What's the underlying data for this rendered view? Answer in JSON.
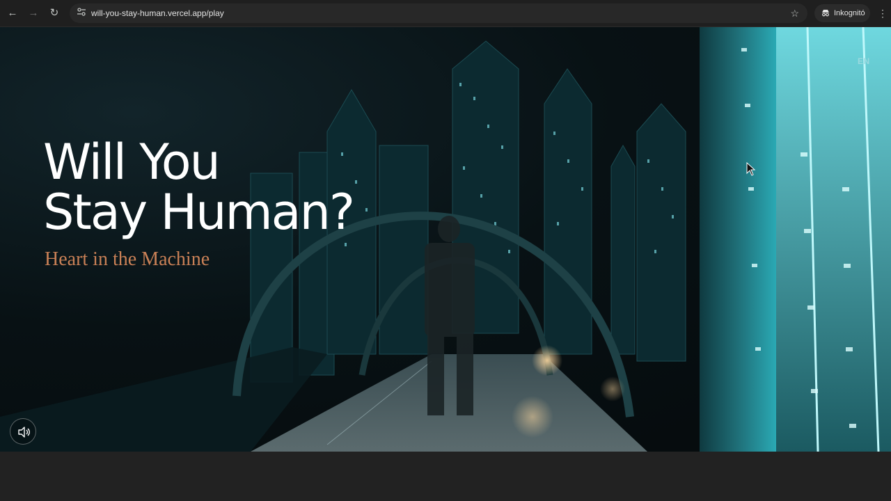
{
  "browser": {
    "url": "will-you-stay-human.vercel.app/play",
    "profile_label": "Inkognitó",
    "icons": {
      "back": "back-arrow-icon",
      "forward": "forward-arrow-icon",
      "reload": "reload-icon",
      "site_info": "site-info-icon",
      "bookmark": "star-icon",
      "incognito": "incognito-icon",
      "menu": "kebab-menu-icon"
    }
  },
  "page": {
    "language_label": "EN",
    "title_line1": "Will You",
    "title_line2": "Stay Human?",
    "subtitle": "Heart in the Machine",
    "sound_icon": "speaker-icon",
    "colors": {
      "title": "#ffffff",
      "subtitle": "#c98056",
      "accent": "#5fe3ec"
    }
  }
}
